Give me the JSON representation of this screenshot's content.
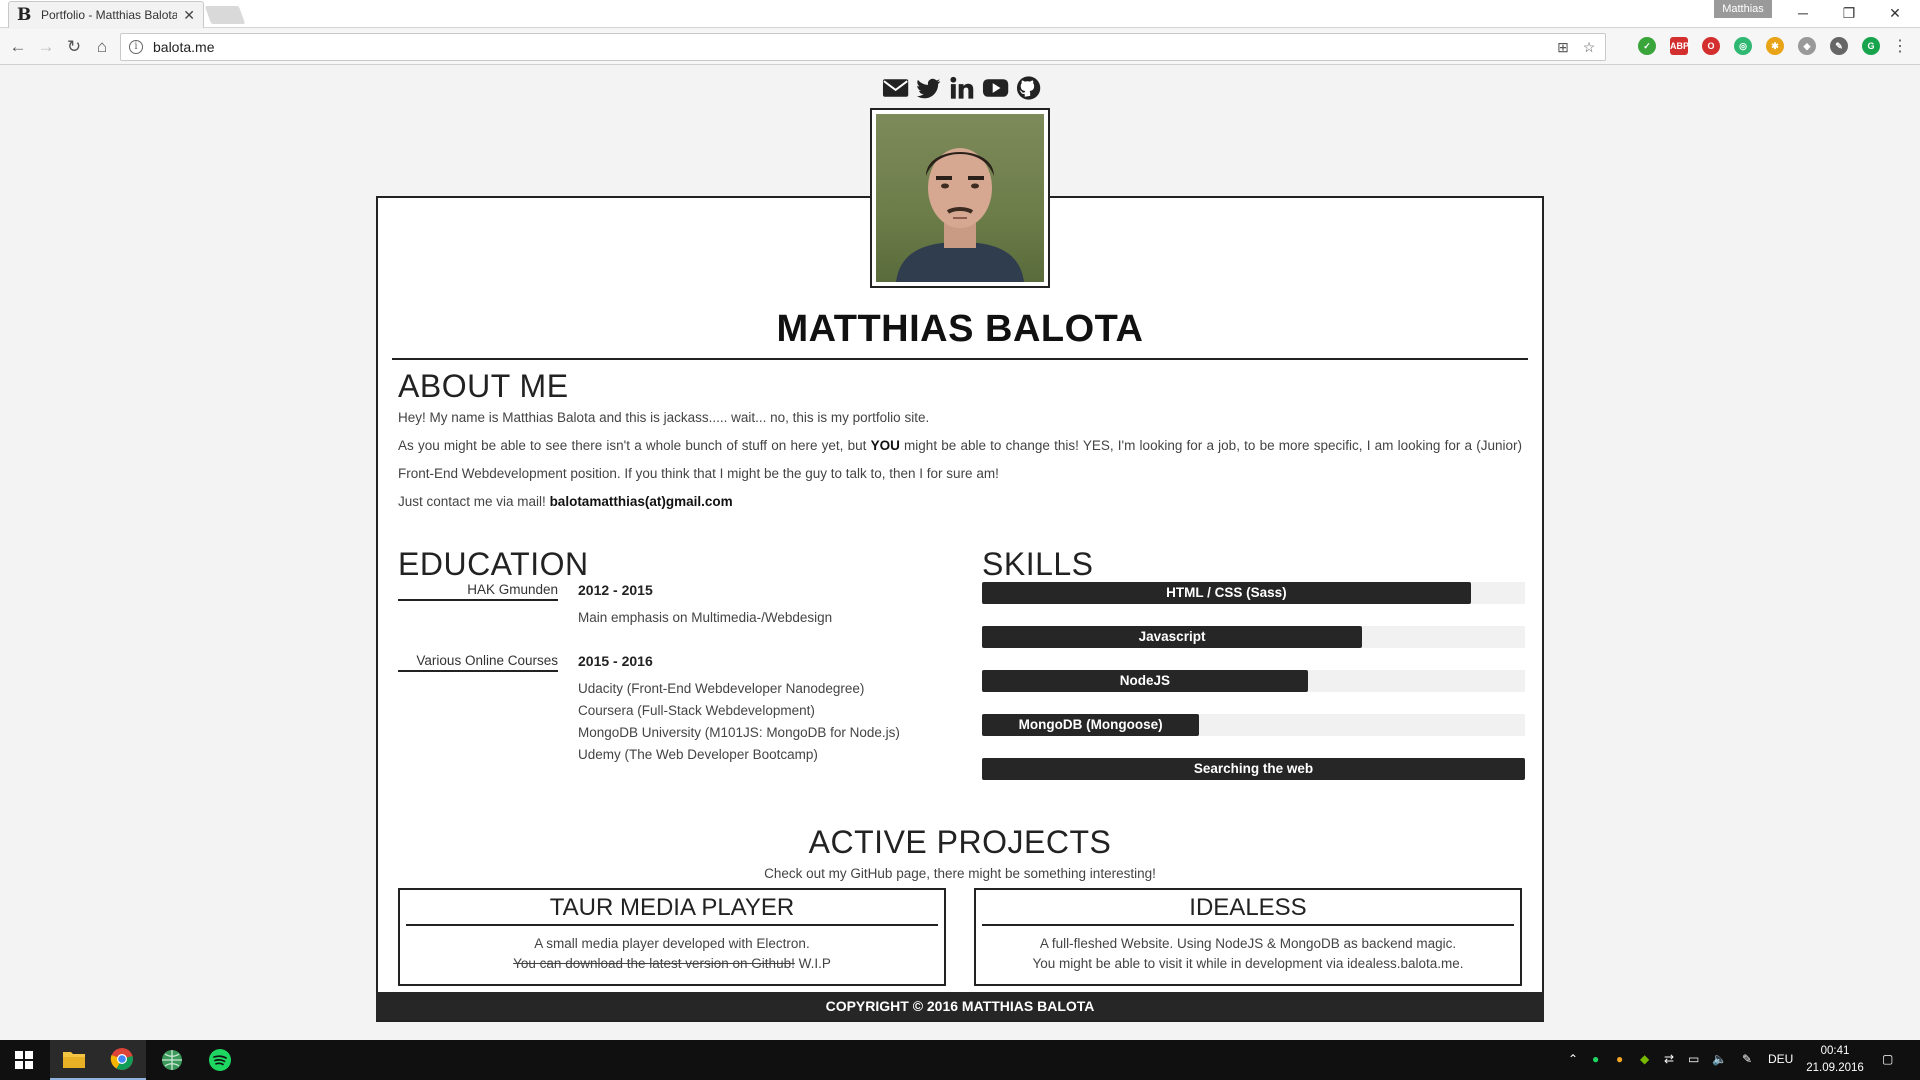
{
  "browser": {
    "tab_title": "Portfolio - Matthias Balota",
    "tab_favicon": "B",
    "profile_name": "Matthias",
    "url": "balota.me"
  },
  "social_icons": [
    "mail-icon",
    "twitter-icon",
    "linkedin-icon",
    "youtube-icon",
    "github-icon"
  ],
  "profile": {
    "name": "MATTHIAS BALOTA"
  },
  "about": {
    "heading": "ABOUT ME",
    "p1": "Hey! My name is Matthias Balota and this is jackass..... wait... no, this is my portfolio site.",
    "p2_before": "As you might be able to see there isn't a whole bunch of stuff on here yet, but ",
    "p2_bold": "YOU",
    "p2_after": " might be able to change this! YES, I'm looking for a job, to be more specific, I am looking for a (Junior) Front-End Webdevelopment position. If you think that I might be the guy to talk to, then I for sure am!",
    "p3_before": "Just contact me via mail! ",
    "p3_email": "balotamatthias(at)gmail.com"
  },
  "education": {
    "heading": "EDUCATION",
    "entries": [
      {
        "label": "HAK Gmunden",
        "years": "2012 - 2015",
        "lines": [
          "Main emphasis on Multimedia-/Webdesign"
        ]
      },
      {
        "label": "Various Online Courses",
        "years": "2015 - 2016",
        "lines": [
          "Udacity (Front-End Webdeveloper Nanodegree)",
          "Coursera (Full-Stack Webdevelopment)",
          "MongoDB University (M101JS: MongoDB for Node.js)",
          "Udemy (The Web Developer Bootcamp)"
        ]
      }
    ]
  },
  "skills": {
    "heading": "SKILLS",
    "items": [
      {
        "label": "HTML / CSS (Sass)",
        "level": 0.9
      },
      {
        "label": "Javascript",
        "level": 0.7
      },
      {
        "label": "NodeJS",
        "level": 0.6
      },
      {
        "label": "MongoDB (Mongoose)",
        "level": 0.4
      },
      {
        "label": "Searching the web",
        "level": 1.0
      }
    ]
  },
  "projects": {
    "heading": "ACTIVE PROJECTS",
    "subtitle": "Check out my GitHub page, there might be something interesting!",
    "items": [
      {
        "title": "TAUR MEDIA PLAYER",
        "line1": "A small media player developed with Electron.",
        "line2_strike": "You can download the latest version on Github!",
        "line2_after": " W.I.P"
      },
      {
        "title": "IDEALESS",
        "line1": "A full-fleshed Website. Using NodeJS & MongoDB as backend magic.",
        "line2": "You might be able to visit it while in development via idealess.balota.me."
      }
    ]
  },
  "footer": {
    "text": "COPYRIGHT © 2016 MATTHIAS BALOTA"
  },
  "taskbar": {
    "language": "DEU",
    "time": "00:41",
    "date": "21.09.2016"
  },
  "colors": {
    "accent": "#262626",
    "page_bg": "#f3f3f3"
  }
}
